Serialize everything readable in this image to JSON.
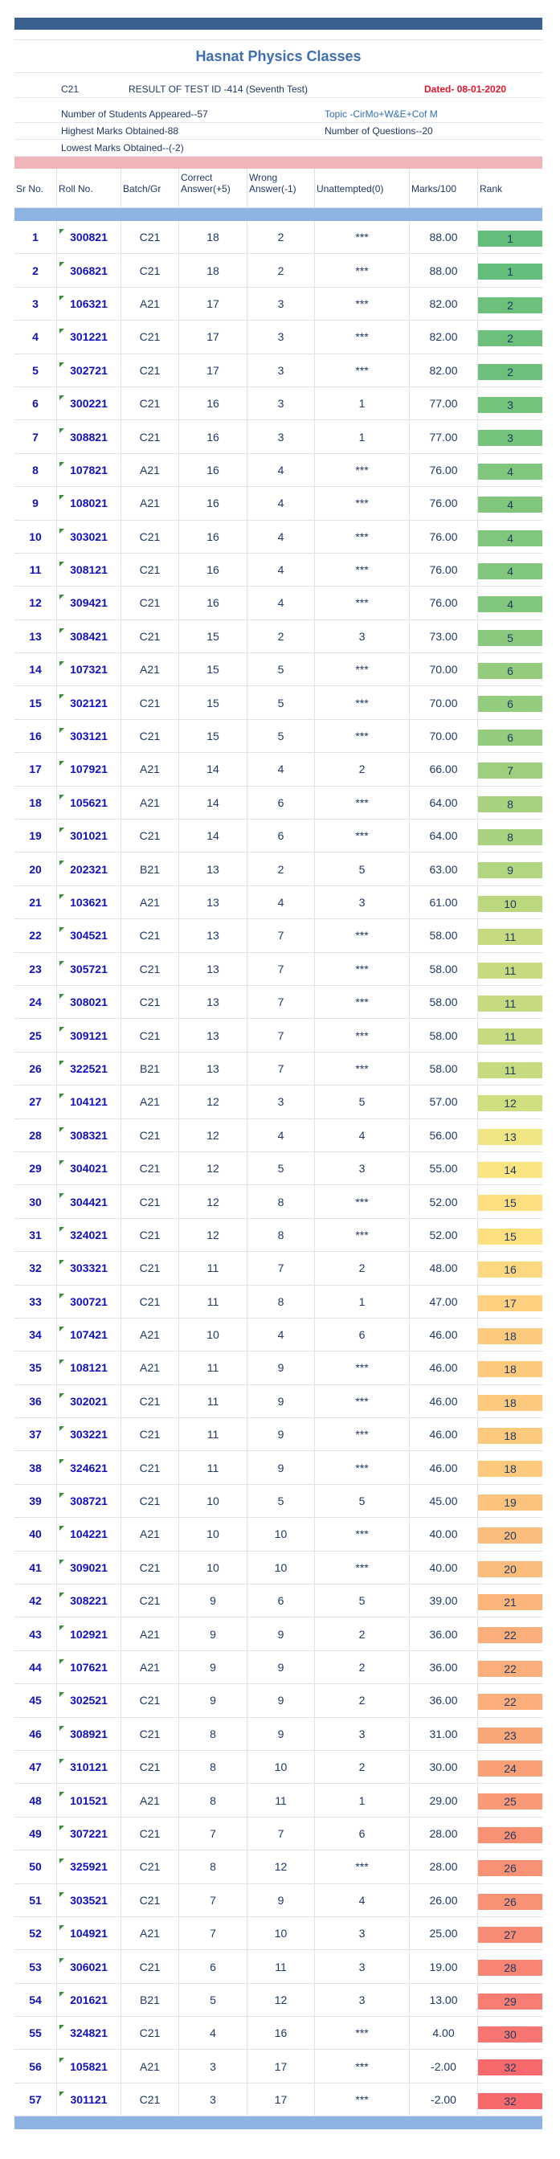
{
  "header": {
    "title": "Hasnat Physics Classes",
    "batch": "C21",
    "result_line": "RESULT OF TEST ID -414  (Seventh Test)",
    "dated": "Dated- 08-01-2020",
    "students": "Number of Students Appeared--57",
    "topic": "Topic -CirMo+W&E+Cof M",
    "highest": "Highest Marks Obtained-88",
    "questions": "Number of Questions--20",
    "lowest": "Lowest Marks Obtained--(-2)"
  },
  "columns": [
    "Sr No.",
    "Roll No.",
    "Batch/Gr",
    "Correct Answer(+5)",
    "Wrong Answer(-1)",
    "Unattempted(0)",
    "Marks/100",
    "Rank"
  ],
  "colors": {
    "title": "#3e6fb1",
    "dated": "#e0162b",
    "top_bar": "#3b6190",
    "pink_bar": "#f0b5b9",
    "blue_bar": "#8db3e2"
  },
  "rows": [
    {
      "sr": "1",
      "roll": "300821",
      "batch": "C21",
      "correct": "18",
      "wrong": "2",
      "un": "***",
      "marks": "88.00",
      "rank": "1",
      "color": "#63be7b"
    },
    {
      "sr": "2",
      "roll": "306821",
      "batch": "C21",
      "correct": "18",
      "wrong": "2",
      "un": "***",
      "marks": "88.00",
      "rank": "1",
      "color": "#63be7b"
    },
    {
      "sr": "3",
      "roll": "106321",
      "batch": "A21",
      "correct": "17",
      "wrong": "3",
      "un": "***",
      "marks": "82.00",
      "rank": "2",
      "color": "#6dc07b"
    },
    {
      "sr": "4",
      "roll": "301221",
      "batch": "C21",
      "correct": "17",
      "wrong": "3",
      "un": "***",
      "marks": "82.00",
      "rank": "2",
      "color": "#6dc07b"
    },
    {
      "sr": "5",
      "roll": "302721",
      "batch": "C21",
      "correct": "17",
      "wrong": "3",
      "un": "***",
      "marks": "82.00",
      "rank": "2",
      "color": "#6dc07b"
    },
    {
      "sr": "6",
      "roll": "300221",
      "batch": "C21",
      "correct": "16",
      "wrong": "3",
      "un": "1",
      "marks": "77.00",
      "rank": "3",
      "color": "#76c37c"
    },
    {
      "sr": "7",
      "roll": "308821",
      "batch": "C21",
      "correct": "16",
      "wrong": "3",
      "un": "1",
      "marks": "77.00",
      "rank": "3",
      "color": "#76c37c"
    },
    {
      "sr": "8",
      "roll": "107821",
      "batch": "A21",
      "correct": "16",
      "wrong": "4",
      "un": "***",
      "marks": "76.00",
      "rank": "4",
      "color": "#80c67c"
    },
    {
      "sr": "9",
      "roll": "108021",
      "batch": "A21",
      "correct": "16",
      "wrong": "4",
      "un": "***",
      "marks": "76.00",
      "rank": "4",
      "color": "#80c67c"
    },
    {
      "sr": "10",
      "roll": "303021",
      "batch": "C21",
      "correct": "16",
      "wrong": "4",
      "un": "***",
      "marks": "76.00",
      "rank": "4",
      "color": "#80c67c"
    },
    {
      "sr": "11",
      "roll": "308121",
      "batch": "C21",
      "correct": "16",
      "wrong": "4",
      "un": "***",
      "marks": "76.00",
      "rank": "4",
      "color": "#80c67c"
    },
    {
      "sr": "12",
      "roll": "309421",
      "batch": "C21",
      "correct": "16",
      "wrong": "4",
      "un": "***",
      "marks": "76.00",
      "rank": "4",
      "color": "#80c67c"
    },
    {
      "sr": "13",
      "roll": "308421",
      "batch": "C21",
      "correct": "15",
      "wrong": "2",
      "un": "3",
      "marks": "73.00",
      "rank": "5",
      "color": "#8ac97d"
    },
    {
      "sr": "14",
      "roll": "107321",
      "batch": "A21",
      "correct": "15",
      "wrong": "5",
      "un": "***",
      "marks": "70.00",
      "rank": "6",
      "color": "#94cc7d"
    },
    {
      "sr": "15",
      "roll": "302121",
      "batch": "C21",
      "correct": "15",
      "wrong": "5",
      "un": "***",
      "marks": "70.00",
      "rank": "6",
      "color": "#94cc7d"
    },
    {
      "sr": "16",
      "roll": "303121",
      "batch": "C21",
      "correct": "15",
      "wrong": "5",
      "un": "***",
      "marks": "70.00",
      "rank": "6",
      "color": "#94cc7d"
    },
    {
      "sr": "17",
      "roll": "107921",
      "batch": "A21",
      "correct": "14",
      "wrong": "4",
      "un": "2",
      "marks": "66.00",
      "rank": "7",
      "color": "#9ecf7e"
    },
    {
      "sr": "18",
      "roll": "105621",
      "batch": "A21",
      "correct": "14",
      "wrong": "6",
      "un": "***",
      "marks": "64.00",
      "rank": "8",
      "color": "#a8d27e"
    },
    {
      "sr": "19",
      "roll": "301021",
      "batch": "C21",
      "correct": "14",
      "wrong": "6",
      "un": "***",
      "marks": "64.00",
      "rank": "8",
      "color": "#a8d27e"
    },
    {
      "sr": "20",
      "roll": "202321",
      "batch": "B21",
      "correct": "13",
      "wrong": "2",
      "un": "5",
      "marks": "63.00",
      "rank": "9",
      "color": "#b2d57f"
    },
    {
      "sr": "21",
      "roll": "103621",
      "batch": "A21",
      "correct": "13",
      "wrong": "4",
      "un": "3",
      "marks": "61.00",
      "rank": "10",
      "color": "#bcd87f"
    },
    {
      "sr": "22",
      "roll": "304521",
      "batch": "C21",
      "correct": "13",
      "wrong": "7",
      "un": "***",
      "marks": "58.00",
      "rank": "11",
      "color": "#c6db80"
    },
    {
      "sr": "23",
      "roll": "305721",
      "batch": "C21",
      "correct": "13",
      "wrong": "7",
      "un": "***",
      "marks": "58.00",
      "rank": "11",
      "color": "#c6db80"
    },
    {
      "sr": "24",
      "roll": "308021",
      "batch": "C21",
      "correct": "13",
      "wrong": "7",
      "un": "***",
      "marks": "58.00",
      "rank": "11",
      "color": "#c6db80"
    },
    {
      "sr": "25",
      "roll": "309121",
      "batch": "C21",
      "correct": "13",
      "wrong": "7",
      "un": "***",
      "marks": "58.00",
      "rank": "11",
      "color": "#c6db80"
    },
    {
      "sr": "26",
      "roll": "322521",
      "batch": "B21",
      "correct": "13",
      "wrong": "7",
      "un": "***",
      "marks": "58.00",
      "rank": "11",
      "color": "#c6db80"
    },
    {
      "sr": "27",
      "roll": "104121",
      "batch": "A21",
      "correct": "12",
      "wrong": "3",
      "un": "5",
      "marks": "57.00",
      "rank": "12",
      "color": "#d0de80"
    },
    {
      "sr": "28",
      "roll": "308321",
      "batch": "C21",
      "correct": "12",
      "wrong": "4",
      "un": "4",
      "marks": "56.00",
      "rank": "13",
      "color": "#f0e583"
    },
    {
      "sr": "29",
      "roll": "304021",
      "batch": "C21",
      "correct": "12",
      "wrong": "5",
      "un": "3",
      "marks": "55.00",
      "rank": "14",
      "color": "#fae582"
    },
    {
      "sr": "30",
      "roll": "304421",
      "batch": "C21",
      "correct": "12",
      "wrong": "8",
      "un": "***",
      "marks": "52.00",
      "rank": "15",
      "color": "#fedf80"
    },
    {
      "sr": "31",
      "roll": "324021",
      "batch": "C21",
      "correct": "12",
      "wrong": "8",
      "un": "***",
      "marks": "52.00",
      "rank": "15",
      "color": "#fedf80"
    },
    {
      "sr": "32",
      "roll": "303321",
      "batch": "C21",
      "correct": "11",
      "wrong": "7",
      "un": "2",
      "marks": "48.00",
      "rank": "16",
      "color": "#fed880"
    },
    {
      "sr": "33",
      "roll": "300721",
      "batch": "C21",
      "correct": "11",
      "wrong": "8",
      "un": "1",
      "marks": "47.00",
      "rank": "17",
      "color": "#fdd17f"
    },
    {
      "sr": "34",
      "roll": "107421",
      "batch": "A21",
      "correct": "10",
      "wrong": "4",
      "un": "6",
      "marks": "46.00",
      "rank": "18",
      "color": "#fdca7d"
    },
    {
      "sr": "35",
      "roll": "108121",
      "batch": "A21",
      "correct": "11",
      "wrong": "9",
      "un": "***",
      "marks": "46.00",
      "rank": "18",
      "color": "#fdca7d"
    },
    {
      "sr": "36",
      "roll": "302021",
      "batch": "C21",
      "correct": "11",
      "wrong": "9",
      "un": "***",
      "marks": "46.00",
      "rank": "18",
      "color": "#fdca7d"
    },
    {
      "sr": "37",
      "roll": "303221",
      "batch": "C21",
      "correct": "11",
      "wrong": "9",
      "un": "***",
      "marks": "46.00",
      "rank": "18",
      "color": "#fdca7d"
    },
    {
      "sr": "38",
      "roll": "324621",
      "batch": "C21",
      "correct": "11",
      "wrong": "9",
      "un": "***",
      "marks": "46.00",
      "rank": "18",
      "color": "#fdca7d"
    },
    {
      "sr": "39",
      "roll": "308721",
      "batch": "C21",
      "correct": "10",
      "wrong": "5",
      "un": "5",
      "marks": "45.00",
      "rank": "19",
      "color": "#fcc37c"
    },
    {
      "sr": "40",
      "roll": "104221",
      "batch": "A21",
      "correct": "10",
      "wrong": "10",
      "un": "***",
      "marks": "40.00",
      "rank": "20",
      "color": "#fcbc7b"
    },
    {
      "sr": "41",
      "roll": "309021",
      "batch": "C21",
      "correct": "10",
      "wrong": "10",
      "un": "***",
      "marks": "40.00",
      "rank": "20",
      "color": "#fcbc7b"
    },
    {
      "sr": "42",
      "roll": "308221",
      "batch": "C21",
      "correct": "9",
      "wrong": "6",
      "un": "5",
      "marks": "39.00",
      "rank": "21",
      "color": "#fbb57a"
    },
    {
      "sr": "43",
      "roll": "102921",
      "batch": "A21",
      "correct": "9",
      "wrong": "9",
      "un": "2",
      "marks": "36.00",
      "rank": "22",
      "color": "#fbae79"
    },
    {
      "sr": "44",
      "roll": "107621",
      "batch": "A21",
      "correct": "9",
      "wrong": "9",
      "un": "2",
      "marks": "36.00",
      "rank": "22",
      "color": "#fbae79"
    },
    {
      "sr": "45",
      "roll": "302521",
      "batch": "C21",
      "correct": "9",
      "wrong": "9",
      "un": "2",
      "marks": "36.00",
      "rank": "22",
      "color": "#fbae79"
    },
    {
      "sr": "46",
      "roll": "308921",
      "batch": "C21",
      "correct": "8",
      "wrong": "9",
      "un": "3",
      "marks": "31.00",
      "rank": "23",
      "color": "#faa778"
    },
    {
      "sr": "47",
      "roll": "310121",
      "batch": "C21",
      "correct": "8",
      "wrong": "10",
      "un": "2",
      "marks": "30.00",
      "rank": "24",
      "color": "#faa077"
    },
    {
      "sr": "48",
      "roll": "101521",
      "batch": "A21",
      "correct": "8",
      "wrong": "11",
      "un": "1",
      "marks": "29.00",
      "rank": "25",
      "color": "#f99976"
    },
    {
      "sr": "49",
      "roll": "307221",
      "batch": "C21",
      "correct": "7",
      "wrong": "7",
      "un": "6",
      "marks": "28.00",
      "rank": "26",
      "color": "#f99275"
    },
    {
      "sr": "50",
      "roll": "325921",
      "batch": "C21",
      "correct": "8",
      "wrong": "12",
      "un": "***",
      "marks": "28.00",
      "rank": "26",
      "color": "#f99275"
    },
    {
      "sr": "51",
      "roll": "303521",
      "batch": "C21",
      "correct": "7",
      "wrong": "9",
      "un": "4",
      "marks": "26.00",
      "rank": "26",
      "color": "#f99275"
    },
    {
      "sr": "52",
      "roll": "104921",
      "batch": "A21",
      "correct": "7",
      "wrong": "10",
      "un": "3",
      "marks": "25.00",
      "rank": "27",
      "color": "#f88b74"
    },
    {
      "sr": "53",
      "roll": "306021",
      "batch": "C21",
      "correct": "6",
      "wrong": "11",
      "un": "3",
      "marks": "19.00",
      "rank": "28",
      "color": "#f88473"
    },
    {
      "sr": "54",
      "roll": "201621",
      "batch": "B21",
      "correct": "5",
      "wrong": "12",
      "un": "3",
      "marks": "13.00",
      "rank": "29",
      "color": "#f87d72"
    },
    {
      "sr": "55",
      "roll": "324821",
      "batch": "C21",
      "correct": "4",
      "wrong": "16",
      "un": "***",
      "marks": "4.00",
      "rank": "30",
      "color": "#f87671"
    },
    {
      "sr": "56",
      "roll": "105821",
      "batch": "A21",
      "correct": "3",
      "wrong": "17",
      "un": "***",
      "marks": "-2.00",
      "rank": "32",
      "color": "#f8696b"
    },
    {
      "sr": "57",
      "roll": "301121",
      "batch": "C21",
      "correct": "3",
      "wrong": "17",
      "un": "***",
      "marks": "-2.00",
      "rank": "32",
      "color": "#f8696b"
    }
  ]
}
